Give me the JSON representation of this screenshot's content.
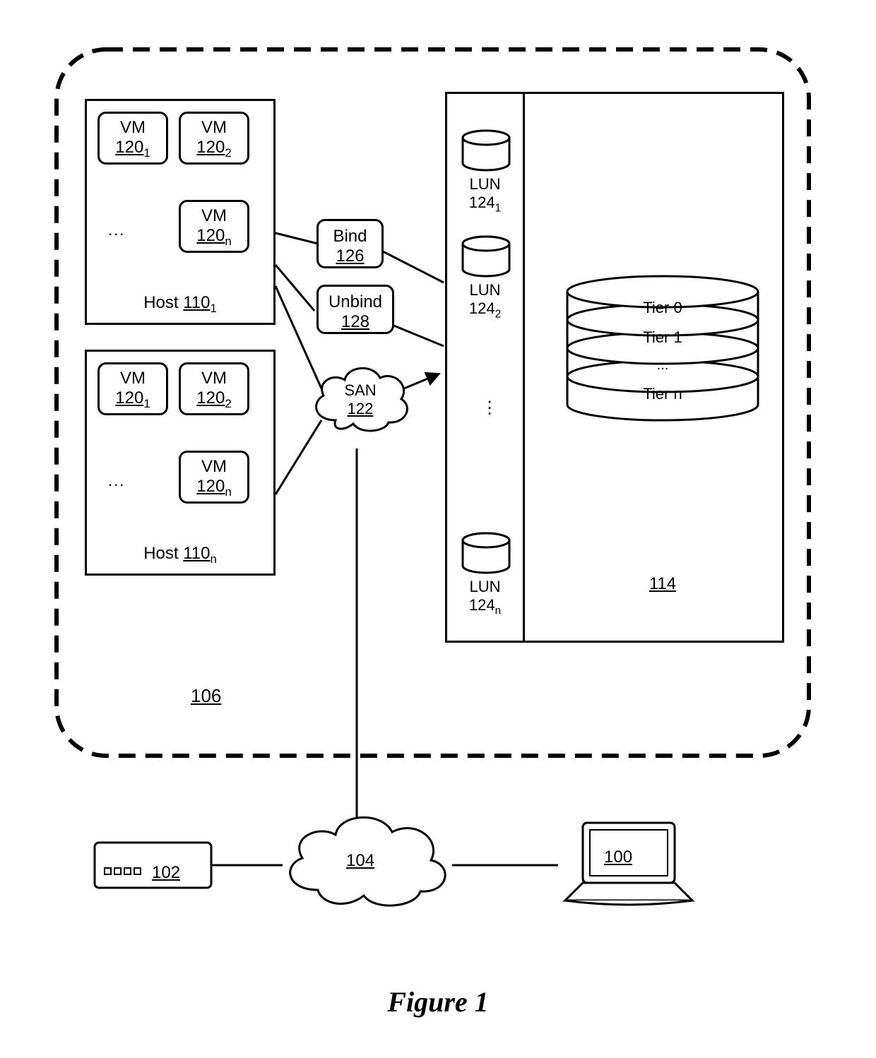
{
  "figure_label": "Figure 1",
  "system_ref": "106",
  "host1": {
    "label_prefix": "Host ",
    "ref": "110",
    "sub": "1",
    "vm1": {
      "label": "VM",
      "ref": "120",
      "sub": "1"
    },
    "vm2": {
      "label": "VM",
      "ref": "120",
      "sub": "2"
    },
    "vmn": {
      "label": "VM",
      "ref": "120",
      "sub": "n"
    }
  },
  "host2": {
    "label_prefix": "Host ",
    "ref": "110",
    "sub": "n",
    "vm1": {
      "label": "VM",
      "ref": "120",
      "sub": "1"
    },
    "vm2": {
      "label": "VM",
      "ref": "120",
      "sub": "2"
    },
    "vmn": {
      "label": "VM",
      "ref": "120",
      "sub": "n"
    }
  },
  "bind": {
    "label": "Bind",
    "ref": "126"
  },
  "unbind": {
    "label": "Unbind",
    "ref": "128"
  },
  "san": {
    "label": "SAN",
    "ref": "122"
  },
  "storage": {
    "ref": "114",
    "lun1": {
      "label": "LUN",
      "ref": "124",
      "sub": "1"
    },
    "lun2": {
      "label": "LUN",
      "ref": "124",
      "sub": "2"
    },
    "lunn": {
      "label": "LUN",
      "ref": "124",
      "sub": "n"
    },
    "tiers": [
      "Tier 0",
      "Tier 1",
      "...",
      "Tier n"
    ]
  },
  "net_cloud_ref": "104",
  "appliance_ref": "102",
  "laptop_ref": "100",
  "ellipsis": "...",
  "vdots": "⋮"
}
